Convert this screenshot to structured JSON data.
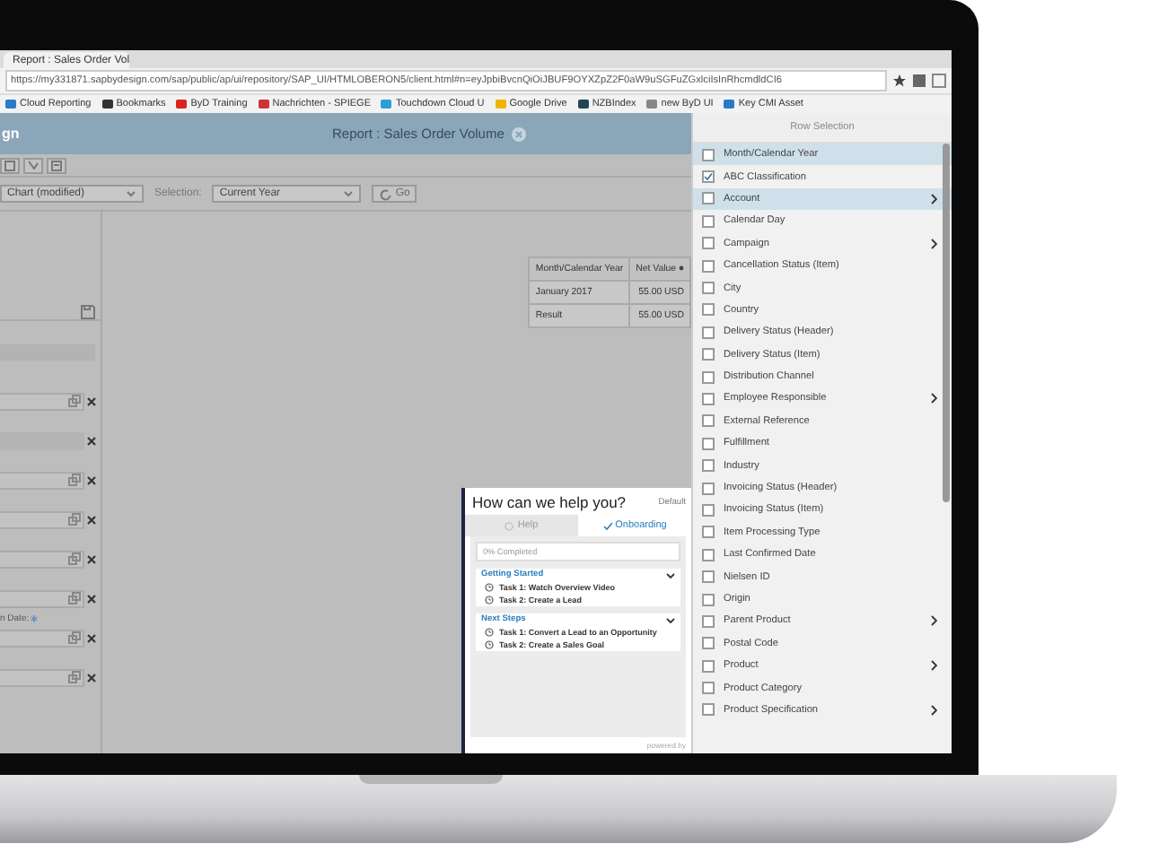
{
  "browser": {
    "tab_title": "Report : Sales Order Vol",
    "url": "https://my331871.sapbydesign.com/sap/public/ap/ui/repository/SAP_UI/HTMLOBERON5/client.html#n=eyJpbiBvcnQiOiJBUF9OYXZpZ2F0aW9uSGFuZGxlciIsInRhcmdldCI6",
    "bookmarks": [
      {
        "label": "Cloud Reporting"
      },
      {
        "label": "Bookmarks"
      },
      {
        "label": "ByD Training"
      },
      {
        "label": "Nachrichten - SPIEGE"
      },
      {
        "label": "Touchdown Cloud U"
      },
      {
        "label": "Google Drive"
      },
      {
        "label": "NZBIndex"
      },
      {
        "label": "new ByD UI"
      },
      {
        "label": "Key CMI Asset"
      }
    ]
  },
  "app": {
    "brand": "gn",
    "title": "Report : Sales Order Volume",
    "selection_bar": {
      "view": "Chart (modified)",
      "selection_label": "Selection:",
      "selection": "Current Year",
      "go": "Go"
    },
    "filters": [
      {
        "disabled": false
      },
      {
        "disabled": true
      },
      {
        "disabled": false
      },
      {
        "disabled": false
      },
      {
        "disabled": false
      },
      {
        "disabled": false
      },
      {
        "disabled": false,
        "label": "n Date:",
        "required": true
      },
      {
        "disabled": false
      }
    ],
    "table": {
      "columns": [
        "Month/Calendar Year",
        "Net Value"
      ],
      "rows": [
        [
          "January 2017",
          "55.00 USD"
        ],
        [
          "Result",
          "55.00 USD"
        ]
      ]
    }
  },
  "help": {
    "title": "How can we help you?",
    "mode": "Default",
    "tabs": [
      {
        "label": "Help",
        "selected": false
      },
      {
        "label": "Onboarding",
        "selected": true
      }
    ],
    "progress": "0% Completed",
    "sections": [
      {
        "title": "Getting Started",
        "tasks": [
          "Task 1: Watch Overview Video",
          "Task 2: Create a Lead"
        ]
      },
      {
        "title": "Next Steps",
        "tasks": [
          "Task 1: Convert a Lead to an Opportunity",
          "Task 2: Create a Sales Goal"
        ]
      }
    ],
    "footer": "powered by"
  },
  "row_selection": {
    "title": "Row Selection",
    "items": [
      {
        "label": "Month/Calendar Year",
        "checked": false,
        "highlighted": true,
        "submenu": false
      },
      {
        "label": "ABC Classification",
        "checked": true,
        "highlighted": false,
        "submenu": false
      },
      {
        "label": "Account",
        "checked": false,
        "highlighted": true,
        "submenu": true
      },
      {
        "label": "Calendar Day",
        "checked": false,
        "highlighted": false,
        "submenu": false
      },
      {
        "label": "Campaign",
        "checked": false,
        "highlighted": false,
        "submenu": true
      },
      {
        "label": "Cancellation Status (Item)",
        "checked": false,
        "highlighted": false,
        "submenu": false
      },
      {
        "label": "City",
        "checked": false,
        "highlighted": false,
        "submenu": false
      },
      {
        "label": "Country",
        "checked": false,
        "highlighted": false,
        "submenu": false
      },
      {
        "label": "Delivery Status (Header)",
        "checked": false,
        "highlighted": false,
        "submenu": false
      },
      {
        "label": "Delivery Status (Item)",
        "checked": false,
        "highlighted": false,
        "submenu": false
      },
      {
        "label": "Distribution Channel",
        "checked": false,
        "highlighted": false,
        "submenu": false
      },
      {
        "label": "Employee Responsible",
        "checked": false,
        "highlighted": false,
        "submenu": true
      },
      {
        "label": "External Reference",
        "checked": false,
        "highlighted": false,
        "submenu": false
      },
      {
        "label": "Fulfillment",
        "checked": false,
        "highlighted": false,
        "submenu": false
      },
      {
        "label": "Industry",
        "checked": false,
        "highlighted": false,
        "submenu": false
      },
      {
        "label": "Invoicing Status (Header)",
        "checked": false,
        "highlighted": false,
        "submenu": false
      },
      {
        "label": "Invoicing Status (Item)",
        "checked": false,
        "highlighted": false,
        "submenu": false
      },
      {
        "label": "Item Processing Type",
        "checked": false,
        "highlighted": false,
        "submenu": false
      },
      {
        "label": "Last Confirmed Date",
        "checked": false,
        "highlighted": false,
        "submenu": false
      },
      {
        "label": "Nielsen ID",
        "checked": false,
        "highlighted": false,
        "submenu": false
      },
      {
        "label": "Origin",
        "checked": false,
        "highlighted": false,
        "submenu": false
      },
      {
        "label": "Parent Product",
        "checked": false,
        "highlighted": false,
        "submenu": true
      },
      {
        "label": "Postal Code",
        "checked": false,
        "highlighted": false,
        "submenu": false
      },
      {
        "label": "Product",
        "checked": false,
        "highlighted": false,
        "submenu": true
      },
      {
        "label": "Product Category",
        "checked": false,
        "highlighted": false,
        "submenu": false
      },
      {
        "label": "Product Specification",
        "checked": false,
        "highlighted": false,
        "submenu": true
      }
    ]
  }
}
